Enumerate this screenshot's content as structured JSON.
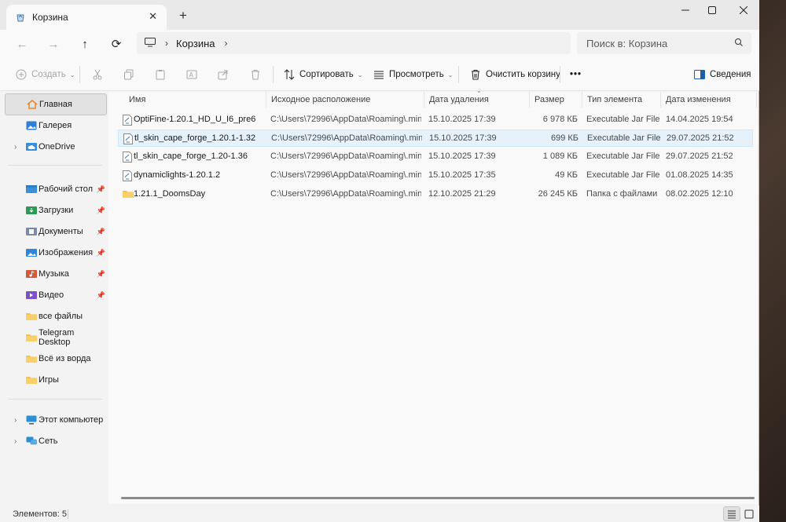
{
  "titlebar": {
    "tab_title": "Корзина",
    "tab_close": "✕",
    "new_tab": "+",
    "minimize": "—",
    "maximize": "☐",
    "close": "✕"
  },
  "nav": {
    "back": "←",
    "forward": "→",
    "up": "↑",
    "refresh": "⟳",
    "breadcrumb": [
      "Корзина"
    ],
    "search_placeholder": "Поиск в: Корзина"
  },
  "commands": {
    "create": "Создать",
    "sort": "Сортировать",
    "view": "Просмотреть",
    "empty_bin": "Очистить корзину",
    "more": "•••",
    "details": "Сведения"
  },
  "sidebar": {
    "items": [
      {
        "label": "Главная",
        "icon": "home-icon",
        "color": "#f08a2c"
      },
      {
        "label": "Галерея",
        "icon": "gallery-icon",
        "color": "#2f7fd6"
      },
      {
        "label": "OneDrive",
        "icon": "cloud-icon",
        "color": "#1f7ad8"
      },
      {
        "label": "Рабочий стол",
        "icon": "desktop-folder-icon",
        "color": "#3a8fdc"
      },
      {
        "label": "Загрузки",
        "icon": "downloads-folder-icon",
        "color": "#2e9a57"
      },
      {
        "label": "Документы",
        "icon": "documents-folder-icon",
        "color": "#7a8aa8"
      },
      {
        "label": "Изображения",
        "icon": "pictures-folder-icon",
        "color": "#2f86d8"
      },
      {
        "label": "Музыка",
        "icon": "music-folder-icon",
        "color": "#d2593a"
      },
      {
        "label": "Видео",
        "icon": "videos-folder-icon",
        "color": "#7d4fc9"
      },
      {
        "label": "все файлы",
        "icon": "folder-icon",
        "color": "#f3c24a"
      },
      {
        "label": "Telegram Desktop",
        "icon": "folder-icon",
        "color": "#f3c24a"
      },
      {
        "label": "Всё из ворда",
        "icon": "folder-icon",
        "color": "#f3c24a"
      },
      {
        "label": "Игры",
        "icon": "folder-icon",
        "color": "#f3c24a"
      },
      {
        "label": "Этот компьютер",
        "icon": "computer-icon",
        "color": "#2b8fd6"
      },
      {
        "label": "Сеть",
        "icon": "network-icon",
        "color": "#2b8fd6"
      }
    ]
  },
  "columns": [
    "Имя",
    "Исходное расположение",
    "Дата удаления",
    "Размер",
    "Тип элемента",
    "Дата изменения"
  ],
  "rows": [
    {
      "name": "OptiFine-1.20.1_HD_U_I6_pre6",
      "location": "C:\\Users\\72996\\AppData\\Roaming\\.mine...",
      "deleted": "15.10.2025 17:39",
      "size": "6 978 КБ",
      "type": "Executable Jar File",
      "modified": "14.04.2025 19:54",
      "icon": "jar-file-icon"
    },
    {
      "name": "tl_skin_cape_forge_1.20.1-1.32",
      "location": "C:\\Users\\72996\\AppData\\Roaming\\.mine...",
      "deleted": "15.10.2025 17:39",
      "size": "699 КБ",
      "type": "Executable Jar File",
      "modified": "29.07.2025 21:52",
      "icon": "jar-file-icon"
    },
    {
      "name": "tl_skin_cape_forge_1.20-1.36",
      "location": "C:\\Users\\72996\\AppData\\Roaming\\.mine...",
      "deleted": "15.10.2025 17:39",
      "size": "1 089 КБ",
      "type": "Executable Jar File",
      "modified": "29.07.2025 21:52",
      "icon": "jar-file-icon"
    },
    {
      "name": "dynamiclights-1.20.1.2",
      "location": "C:\\Users\\72996\\AppData\\Roaming\\.mine...",
      "deleted": "15.10.2025 17:35",
      "size": "49 КБ",
      "type": "Executable Jar File",
      "modified": "01.08.2025 14:35",
      "icon": "jar-file-icon"
    },
    {
      "name": "1.21.1_DoomsDay",
      "location": "C:\\Users\\72996\\AppData\\Roaming\\.mine...",
      "deleted": "12.10.2025 21:29",
      "size": "26 245 КБ",
      "type": "Папка с файлами",
      "modified": "08.02.2025 12:10",
      "icon": "folder-icon"
    }
  ],
  "status": {
    "count": "Элементов: 5"
  },
  "colors": {
    "selection": "#e5f1fb",
    "folder": "#f3c24a"
  }
}
